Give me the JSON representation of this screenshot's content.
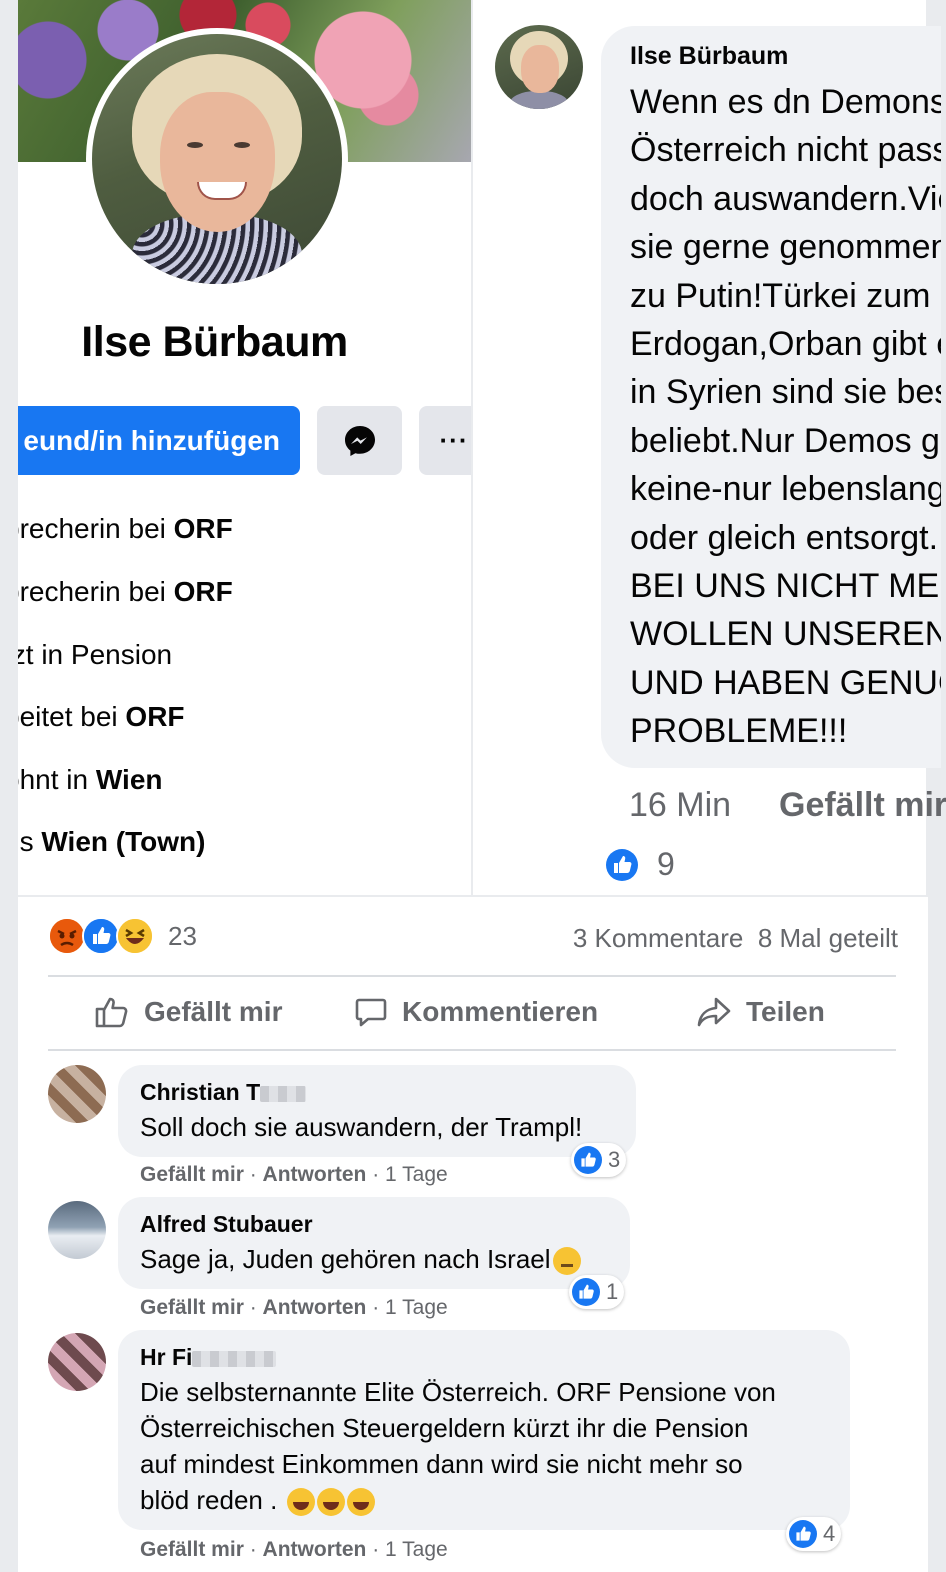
{
  "profile": {
    "name": "Ilse Bürbaum",
    "add_friend_label": "eund/in hinzufügen",
    "more_label": "···",
    "intro": [
      {
        "prefix": "precherin bei ",
        "bold": "ORF"
      },
      {
        "prefix": "precherin bei ",
        "bold": "ORF"
      },
      {
        "prefix": "tzt in Pension",
        "bold": ""
      },
      {
        "prefix": "beitet bei ",
        "bold": "ORF"
      },
      {
        "prefix": "ohnt in ",
        "bold": "Wien"
      },
      {
        "prefix": "us ",
        "bold": "Wien (Town)"
      }
    ]
  },
  "post": {
    "author": "Ilse Bürbaum",
    "text": "Wenn es dn Demonstranten in\nÖsterreich nicht passt,sollen sie\ndoch auswandern.Vielleicht werden\nsie gerne genommen.Russland\nzu Putin!Türkei zum\nErdogan,Orban gibt es auch,\nin Syrien sind sie bestimmt\nbeliebt.Nur Demos gibt es dort\nkeine-nur lebenslang Gefängnis\noder gleich entsorgt.\nBEI UNS NICHT MEHR.WIR\nWOLLEN UNSEREN FRIEDEN\nUND HABEN GENUG EIGENE\nPROBLEME!!!",
    "time": "16 Min",
    "like_label": "Gefällt mir",
    "reaction_count": "9"
  },
  "summary": {
    "total_reactions": "23",
    "comments": "3 Kommentare",
    "shares": "8 Mal geteilt"
  },
  "actions": {
    "like": "Gefällt mir",
    "comment": "Kommentieren",
    "share": "Teilen"
  },
  "comments": [
    {
      "author": "Christian T",
      "text": [
        "Soll doch sie auswandern, der Trampl!"
      ],
      "like": "Gefällt mir",
      "reply": "Antworten",
      "time": "1 Tage",
      "likes": "3"
    },
    {
      "author": "Alfred Stubauer",
      "text": [
        "Sage ja, Juden gehören nach Israel"
      ],
      "like": "Gefällt mir",
      "reply": "Antworten",
      "time": "1 Tage",
      "likes": "1"
    },
    {
      "author": "Hr Fi",
      "text": [
        "Die selbsternannte Elite Österreich. ORF Pensione von",
        "Österreichischen Steuergeldern kürzt ihr die Pension",
        "auf mindest Einkommen dann wird sie nicht mehr so",
        "blöd reden ."
      ],
      "like": "Gefällt mir",
      "reply": "Antworten",
      "time": "1 Tage",
      "likes": "4"
    }
  ],
  "colors": {
    "accent": "#1877f2",
    "secondary_text": "#65676b",
    "bubble": "#f0f2f5"
  }
}
